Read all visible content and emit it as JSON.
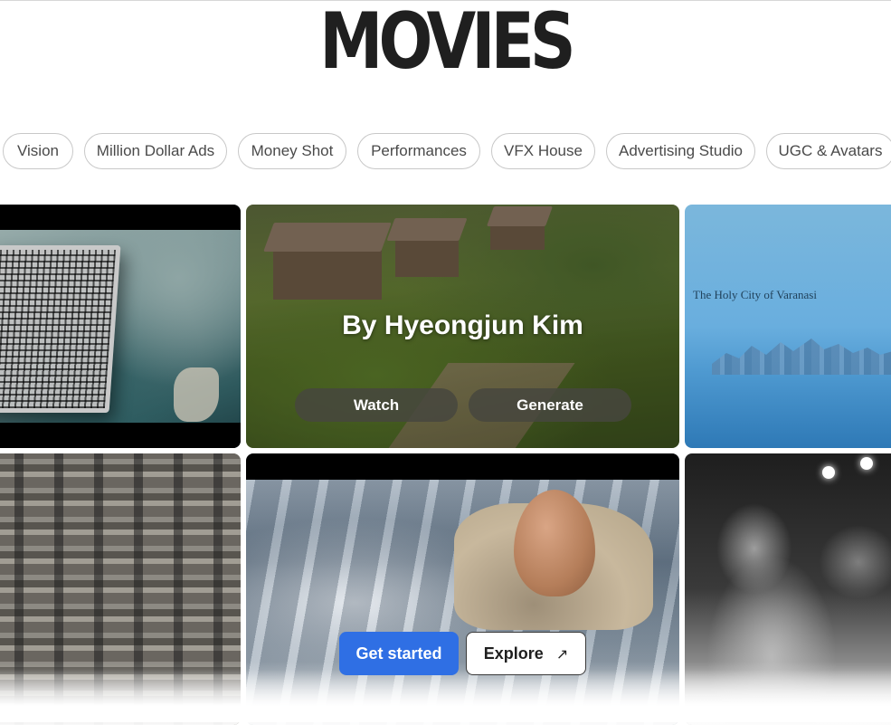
{
  "page": {
    "title": "MOVIES"
  },
  "categories": [
    "Vision",
    "Million Dollar Ads",
    "Money Shot",
    "Performances",
    "VFX House",
    "Advertising Studio",
    "UGC & Avatars"
  ],
  "featured": {
    "headline": "By Hyeongjun Kim",
    "watch_label": "Watch",
    "generate_label": "Generate"
  },
  "cards": {
    "varanasi_caption": "The Holy City of Varanasi"
  },
  "cta": {
    "get_started_label": "Get started",
    "explore_label": "Explore",
    "explore_icon": "arrow-up-right-icon"
  },
  "colors": {
    "primary": "#2f6fe4",
    "title": "#1f1f1f"
  }
}
